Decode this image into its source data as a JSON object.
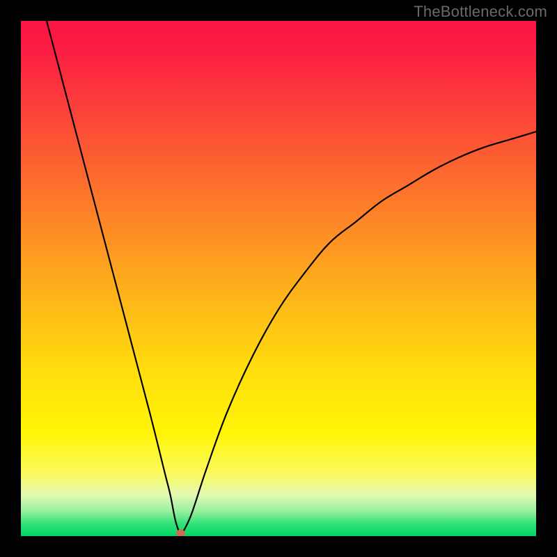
{
  "watermark": "TheBottleneck.com",
  "colors": {
    "background": "#000000",
    "curve": "#000000",
    "marker": "#cf6a4f",
    "gradient_stops": [
      "#fb1346",
      "#fc4a37",
      "#fd7a2a",
      "#feb01b",
      "#ffde0c",
      "#fff506",
      "#fbfa60",
      "#e2f9b3",
      "#9ef0a2",
      "#35e37a",
      "#00d566"
    ]
  },
  "chart_data": {
    "type": "line",
    "title": "",
    "xlabel": "",
    "ylabel": "",
    "xlim": [
      0,
      100
    ],
    "ylim": [
      0,
      100
    ],
    "grid": false,
    "legend": false,
    "note": "V-shaped bottleneck curve; minimum at marker_x. Left branch is near-linear descending; right branch rises with decreasing slope. Values are read off the chart proportions (axes are unlabeled).",
    "marker": {
      "x": 31,
      "y": 0
    },
    "series": [
      {
        "name": "left-branch",
        "x": [
          5,
          10,
          15,
          20,
          25,
          28,
          29,
          30,
          31
        ],
        "values": [
          100,
          81,
          62,
          43,
          24,
          12,
          8,
          3,
          0
        ]
      },
      {
        "name": "right-branch",
        "x": [
          31,
          33,
          36,
          40,
          45,
          50,
          55,
          60,
          65,
          70,
          75,
          80,
          85,
          90,
          95,
          100
        ],
        "values": [
          0,
          4,
          13,
          24,
          35,
          44,
          51,
          57,
          61,
          65,
          68,
          71,
          73.5,
          75.5,
          77,
          78.5
        ]
      }
    ]
  }
}
